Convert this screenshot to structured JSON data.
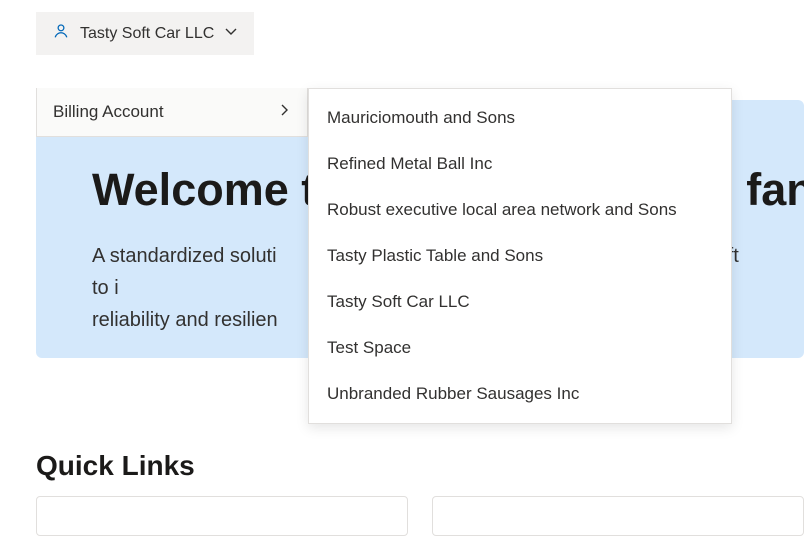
{
  "account": {
    "selected_name": "Tasty Soft Car LLC"
  },
  "dropdown": {
    "billing_account_label": "Billing Account"
  },
  "flyout": {
    "items": [
      "Mauriciomouth and Sons",
      "Refined Metal Ball Inc",
      "Robust executive local area network and Sons",
      "Tasty Plastic Table and Sons",
      "Tasty Soft Car LLC",
      "Test Space",
      "Unbranded Rubber Sausages Inc"
    ]
  },
  "hero": {
    "title_prefix": "Welcome t",
    "title_suffix": "fany",
    "body_line1_prefix": "A standardized soluti",
    "body_line1_suffix": "oft to i",
    "body_line2": "reliability and resilien"
  },
  "sections": {
    "quick_links": "Quick Links"
  }
}
